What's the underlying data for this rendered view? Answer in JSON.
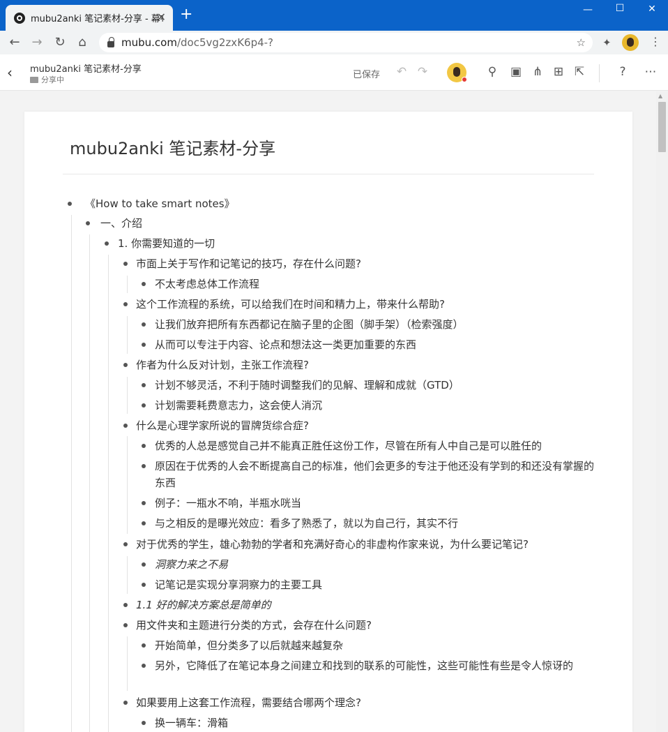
{
  "browser": {
    "tab_title": "mubu2anki 笔记素材-分享 - 幕布",
    "url_host": "mubu.com",
    "url_path": "/doc5vg2zxK6p4-?"
  },
  "header": {
    "doc_title": "mubu2anki 笔记素材-分享",
    "doc_status": "分享中",
    "save_status": "已保存"
  },
  "doc": {
    "title": "mubu2anki 笔记素材-分享",
    "items": [
      {
        "level": 0,
        "text": "《How to take smart notes》"
      },
      {
        "level": 1,
        "text": "一、介绍"
      },
      {
        "level": 2,
        "text": "1. 你需要知道的一切"
      },
      {
        "level": 3,
        "text": "市面上关于写作和记笔记的技巧，存在什么问题?"
      },
      {
        "level": 4,
        "text": "不太考虑总体工作流程"
      },
      {
        "level": 3,
        "text": "这个工作流程的系统，可以给我们在时间和精力上，带来什么帮助?"
      },
      {
        "level": 4,
        "text": "让我们放弃把所有东西都记在脑子里的企图（脚手架）（检索强度）"
      },
      {
        "level": 4,
        "text": "从而可以专注于内容、论点和想法这一类更加重要的东西"
      },
      {
        "level": 3,
        "text": "作者为什么反对计划，主张工作流程?"
      },
      {
        "level": 4,
        "text": "计划不够灵活，不利于随时调整我们的见解、理解和成就（GTD）"
      },
      {
        "level": 4,
        "text": "计划需要耗费意志力，这会使人消沉"
      },
      {
        "level": 3,
        "text": "什么是心理学家所说的冒牌货综合症?"
      },
      {
        "level": 4,
        "text": "优秀的人总是感觉自己并不能真正胜任这份工作，尽管在所有人中自己是可以胜任的"
      },
      {
        "level": 4,
        "text": "原因在于优秀的人会不断提高自己的标准，他们会更多的专注于他还没有学到的和还没有掌握的东西"
      },
      {
        "level": 4,
        "text": "例子：一瓶水不响，半瓶水咣当"
      },
      {
        "level": 4,
        "text": "与之相反的是曝光效应：看多了熟悉了，就以为自己行，其实不行"
      },
      {
        "level": 3,
        "text": "对于优秀的学生，雄心勃勃的学者和充满好奇心的非虚构作家来说，为什么要记笔记?"
      },
      {
        "level": 4,
        "text": "洞察力来之不易"
      },
      {
        "level": 4,
        "text": "记笔记是实现分享洞察力的主要工具"
      },
      {
        "level": 3,
        "text": "1.1 好的解决方案总是简单的"
      },
      {
        "level": 3,
        "text": "用文件夹和主题进行分类的方式，会存在什么问题?"
      },
      {
        "level": 4,
        "text": "开始简单，但分类多了以后就越来越复杂"
      },
      {
        "level": 4,
        "text": "另外，它降低了在笔记本身之间建立和找到的联系的可能性，这些可能性有些是令人惊讶的"
      },
      {
        "level": 3,
        "text": "如果要用上这套工作流程，需要结合哪两个理念?"
      },
      {
        "level": 4,
        "text": "换一辆车：滑箱"
      }
    ]
  },
  "icons": [
    "mubu-logo-icon",
    "close-icon",
    "plus-icon",
    "minimize-icon",
    "maximize-icon",
    "window-close-icon",
    "back-arrow-icon",
    "forward-arrow-icon",
    "reload-icon",
    "home-icon",
    "lock-icon",
    "star-icon",
    "extensions-icon",
    "menu-dots-icon",
    "folder-icon",
    "undo-icon",
    "redo-icon",
    "search-icon",
    "presentation-icon",
    "mindmap-icon",
    "structure-icon",
    "export-icon",
    "help-icon",
    "more-icon"
  ]
}
